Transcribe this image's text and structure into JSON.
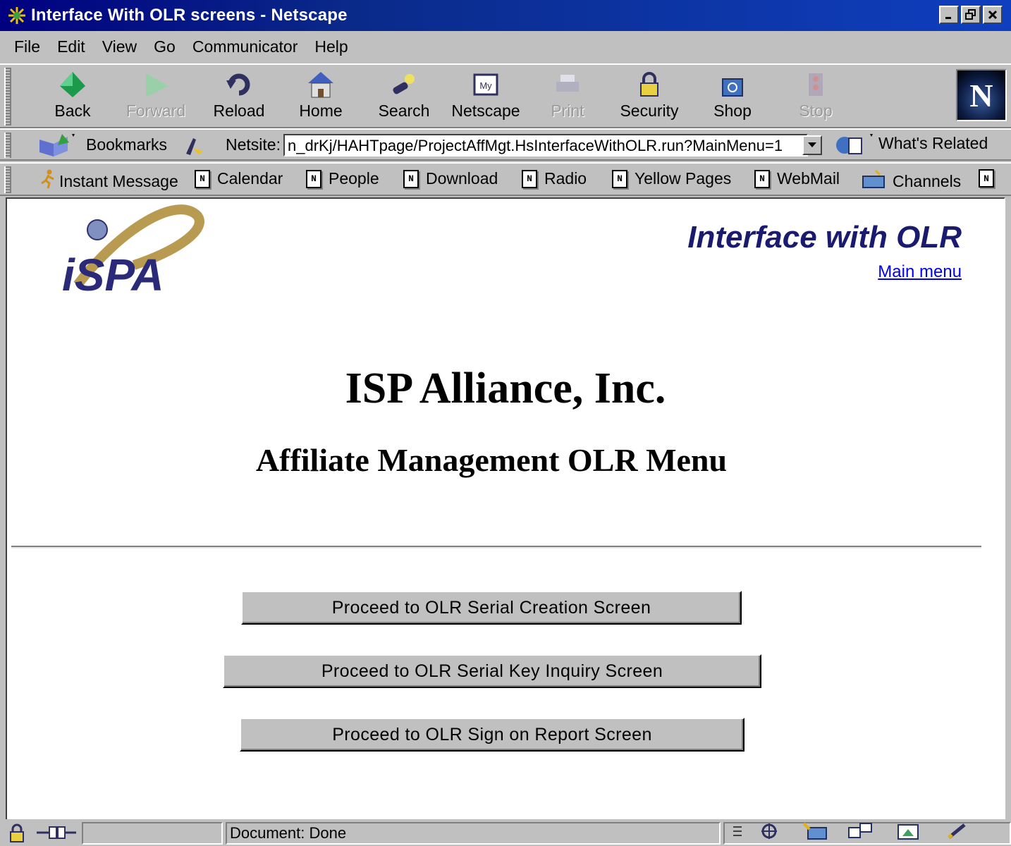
{
  "window": {
    "title": "Interface With OLR screens - Netscape",
    "buttons": [
      "minimize",
      "maximize",
      "close"
    ]
  },
  "menu": [
    "File",
    "Edit",
    "View",
    "Go",
    "Communicator",
    "Help"
  ],
  "nav_toolbar": [
    {
      "label": "Back",
      "icon": "back-arrow-icon",
      "enabled": true
    },
    {
      "label": "Forward",
      "icon": "forward-arrow-icon",
      "enabled": false
    },
    {
      "label": "Reload",
      "icon": "reload-icon",
      "enabled": true
    },
    {
      "label": "Home",
      "icon": "home-icon",
      "enabled": true
    },
    {
      "label": "Search",
      "icon": "search-icon",
      "enabled": true
    },
    {
      "label": "Netscape",
      "icon": "my-netscape-icon",
      "enabled": true
    },
    {
      "label": "Print",
      "icon": "print-icon",
      "enabled": false
    },
    {
      "label": "Security",
      "icon": "lock-icon",
      "enabled": true
    },
    {
      "label": "Shop",
      "icon": "shop-bag-icon",
      "enabled": true
    },
    {
      "label": "Stop",
      "icon": "stop-icon",
      "enabled": false
    }
  ],
  "location": {
    "bookmarks_label": "Bookmarks",
    "netsite_label": "Netsite:",
    "url": "n_drKj/HAHTpage/ProjectAffMgt.HsInterfaceWithOLR.run?MainMenu=1",
    "whats_related": "What's Related"
  },
  "personal_toolbar": [
    "Instant Message",
    "Calendar",
    "People",
    "Download",
    "Radio",
    "Yellow Pages",
    "WebMail",
    "Channels"
  ],
  "page": {
    "logo_text": "iSPA",
    "heading": "Interface with OLR",
    "main_menu_link": "Main menu",
    "company": "ISP Alliance, Inc.",
    "subtitle": "Affiliate Management OLR Menu",
    "buttons": [
      "Proceed to OLR Serial Creation Screen",
      "Proceed to OLR Serial Key Inquiry Screen",
      "Proceed to OLR Sign on Report Screen"
    ]
  },
  "status": {
    "text": "Document: Done"
  },
  "colors": {
    "title_bar": "#000080",
    "chrome": "#c0c0c0",
    "heading": "#1a1a6e",
    "link": "#0000ee"
  }
}
